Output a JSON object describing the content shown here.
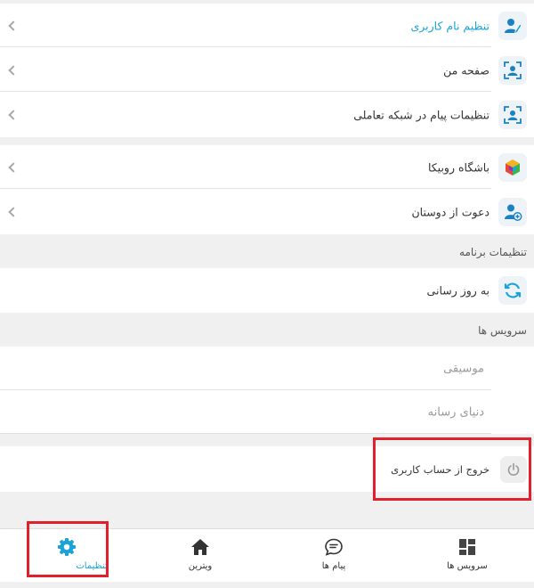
{
  "account_menu": [
    {
      "label": "تنظیم نام کاربری",
      "icon": "user-edit-icon",
      "accent": true
    },
    {
      "label": "صفحه من",
      "icon": "profile-frame-icon",
      "accent": false
    },
    {
      "label": "تنظیمات پیام در شبکه تعاملی",
      "icon": "profile-frame-icon",
      "accent": false
    }
  ],
  "social_menu": [
    {
      "label": "باشگاه روبیکا",
      "icon": "cube-icon"
    },
    {
      "label": "دعوت از دوستان",
      "icon": "invite-friend-icon"
    }
  ],
  "app_settings": {
    "title": "تنظیمات برنامه",
    "update_label": "به روز رسانی"
  },
  "services": {
    "title": "سرویس ها",
    "items": [
      "موسیقی",
      "دنیای رسانه"
    ]
  },
  "logout": {
    "label": "خروج از حساب کاربری",
    "icon": "power-icon"
  },
  "bottom_nav": [
    {
      "label": "سرویس ها",
      "icon": "grid-icon"
    },
    {
      "label": "پیام ها",
      "icon": "chat-icon"
    },
    {
      "label": "ویترین",
      "icon": "home-icon"
    },
    {
      "label": "تنظیمات",
      "icon": "gear-icon",
      "active": true
    }
  ],
  "colors": {
    "accent": "#1aa3d8",
    "highlight_border": "#e0202a",
    "background": "#f0f0f0"
  }
}
